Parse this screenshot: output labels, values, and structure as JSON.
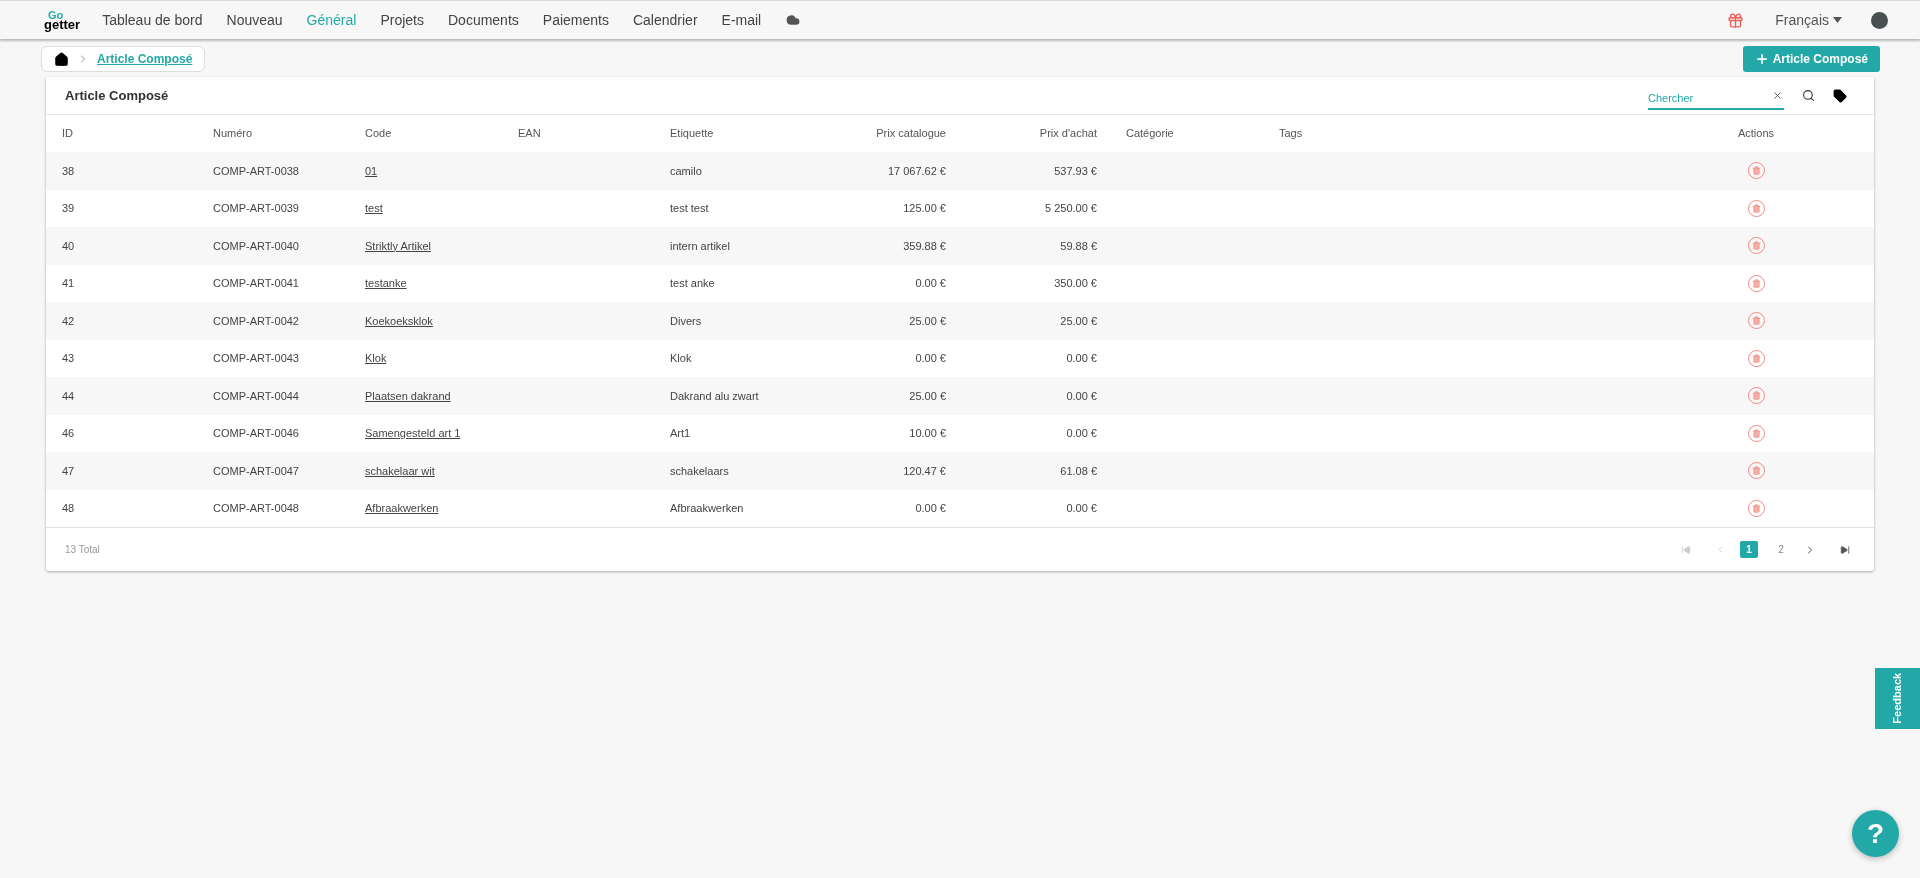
{
  "nav": {
    "logo": {
      "top": "Go",
      "bottom": "getter"
    },
    "items": [
      {
        "label": "Tableau de bord",
        "selected": false
      },
      {
        "label": "Nouveau",
        "selected": false
      },
      {
        "label": "Général",
        "selected": true
      },
      {
        "label": "Projets",
        "selected": false
      },
      {
        "label": "Documents",
        "selected": false
      },
      {
        "label": "Paiements",
        "selected": false
      },
      {
        "label": "Calendrier",
        "selected": false
      },
      {
        "label": "E-mail",
        "selected": false
      }
    ],
    "language": "Français"
  },
  "breadcrumb": {
    "current": "Article Composé"
  },
  "add_button": "Article Composé",
  "card": {
    "title": "Article Composé",
    "search": {
      "placeholder": "Chercher"
    }
  },
  "table": {
    "columns": [
      "ID",
      "Numéro",
      "Code",
      "EAN",
      "Etiquette",
      "Prix catalogue",
      "Prix d'achat",
      "Catégorie",
      "Tags",
      "Actions"
    ],
    "rows": [
      {
        "id": "38",
        "numero": "COMP-ART-0038",
        "code": "01",
        "etiquette": "camilo",
        "prix_catalogue": "17 067.62 €",
        "prix_achat": "537.93 €"
      },
      {
        "id": "39",
        "numero": "COMP-ART-0039",
        "code": "test",
        "etiquette": "test test",
        "prix_catalogue": "125.00 €",
        "prix_achat": "5 250.00 €"
      },
      {
        "id": "40",
        "numero": "COMP-ART-0040",
        "code": "Striktly Artikel",
        "etiquette": "intern artikel",
        "prix_catalogue": "359.88 €",
        "prix_achat": "59.88 €"
      },
      {
        "id": "41",
        "numero": "COMP-ART-0041",
        "code": "testanke",
        "etiquette": "test anke",
        "prix_catalogue": "0.00 €",
        "prix_achat": "350.00 €"
      },
      {
        "id": "42",
        "numero": "COMP-ART-0042",
        "code": "Koekoeksklok",
        "etiquette": "Divers",
        "prix_catalogue": "25.00 €",
        "prix_achat": "25.00 €"
      },
      {
        "id": "43",
        "numero": "COMP-ART-0043",
        "code": "Klok",
        "etiquette": "Klok",
        "prix_catalogue": "0.00 €",
        "prix_achat": "0.00 €"
      },
      {
        "id": "44",
        "numero": "COMP-ART-0044",
        "code": "Plaatsen dakrand",
        "etiquette": "Dakrand alu zwart",
        "prix_catalogue": "25.00 €",
        "prix_achat": "0.00 €"
      },
      {
        "id": "46",
        "numero": "COMP-ART-0046",
        "code": "Samengesteld art 1",
        "etiquette": "Art1",
        "prix_catalogue": "10.00 €",
        "prix_achat": "0.00 €"
      },
      {
        "id": "47",
        "numero": "COMP-ART-0047",
        "code": "schakelaar wit",
        "etiquette": "schakelaars",
        "prix_catalogue": "120.47 €",
        "prix_achat": "61.08 €"
      },
      {
        "id": "48",
        "numero": "COMP-ART-0048",
        "code": "Afbraakwerken",
        "etiquette": "Afbraakwerken",
        "prix_catalogue": "0.00 €",
        "prix_achat": "0.00 €"
      }
    ],
    "total": "13 Total"
  },
  "pagination": {
    "first_disabled": true,
    "prev_disabled": true,
    "pages": [
      {
        "label": "1",
        "selected": true
      },
      {
        "label": "2",
        "selected": false
      }
    ]
  },
  "feedback": "Feedback",
  "help": "?"
}
